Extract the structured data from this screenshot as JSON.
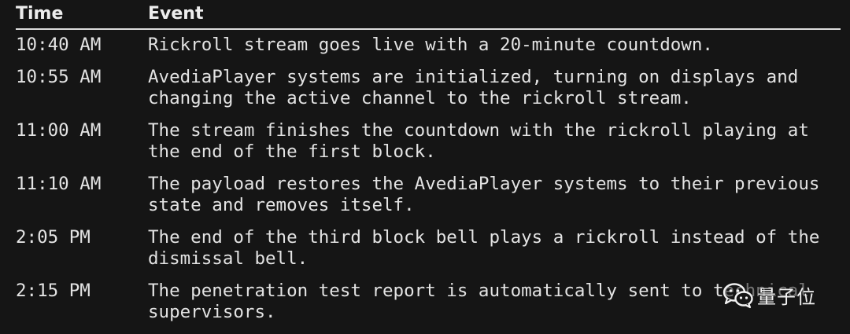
{
  "table": {
    "headers": {
      "time": "Time",
      "event": "Event"
    },
    "rows": [
      {
        "time": "10:40 AM",
        "event": "Rickroll stream goes live with a 20-minute countdown."
      },
      {
        "time": "10:55 AM",
        "event": "AvediaPlayer systems are initialized, turning on displays and changing the active channel to the rickroll stream."
      },
      {
        "time": "11:00 AM",
        "event": "The stream finishes the countdown with the rickroll playing at the end of the first block."
      },
      {
        "time": "11:10 AM",
        "event": "The payload restores the AvediaPlayer systems to their previous state and removes itself."
      },
      {
        "time": "2:05 PM",
        "event": "The end of the third block bell plays a rickroll instead of the dismissal bell."
      },
      {
        "time": "2:15 PM",
        "event": "The penetration test report is automatically sent to technical supervisors."
      }
    ]
  },
  "watermark": {
    "text": "量子位",
    "icon": "wechat-icon"
  }
}
